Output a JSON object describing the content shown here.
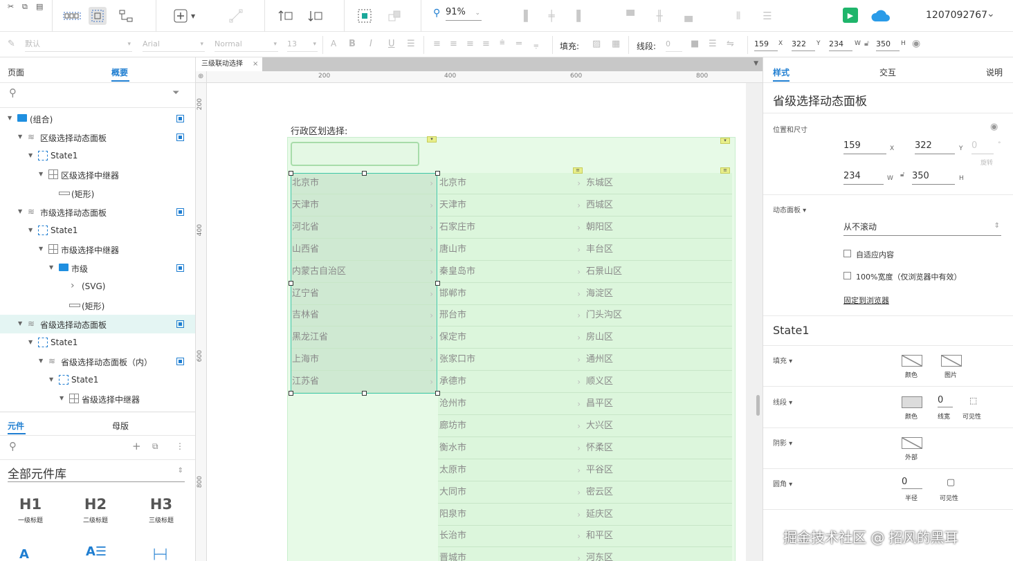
{
  "toolbar": {
    "zoom": "91%",
    "user_id": "1207092767"
  },
  "format_bar": {
    "style_select": "默认",
    "font_select": "Arial",
    "weight_select": "Normal",
    "size_select": "13",
    "fill_label": "填充:",
    "stroke_label": "线段:",
    "stroke_value": "0",
    "x_value": "159",
    "x_label": "X",
    "y_value": "322",
    "y_label": "Y",
    "w_value": "234",
    "w_label": "W",
    "h_value": "350",
    "h_label": "H"
  },
  "left_panel": {
    "tab_pages": "页面",
    "tab_outline": "概要",
    "tree": [
      {
        "label": "(组合)"
      },
      {
        "label": "区级选择动态面板"
      },
      {
        "label": "State1"
      },
      {
        "label": "区级选择中继器"
      },
      {
        "label": "(矩形)"
      },
      {
        "label": "市级选择动态面板"
      },
      {
        "label": "State1"
      },
      {
        "label": "市级选择中继器"
      },
      {
        "label": "市级"
      },
      {
        "label": "(SVG)"
      },
      {
        "label": "(矩形)"
      },
      {
        "label": "省级选择动态面板"
      },
      {
        "label": "State1"
      },
      {
        "label": "省级选择动态面板（内）"
      },
      {
        "label": "State1"
      },
      {
        "label": "省级选择中继器"
      }
    ],
    "tab_widgets": "元件",
    "tab_masters": "母版",
    "library_select": "全部元件库",
    "widgets": [
      {
        "glyph": "H1",
        "label": "一级标题"
      },
      {
        "glyph": "H2",
        "label": "二级标题"
      },
      {
        "glyph": "H3",
        "label": "三级标题"
      }
    ]
  },
  "canvas": {
    "doc_tab": "三级联动选择",
    "ruler_h": [
      "200",
      "400",
      "600",
      "800"
    ],
    "ruler_v": [
      "200",
      "400",
      "600",
      "800"
    ],
    "prompt_label": "行政区划选择:",
    "provinces": [
      "北京市",
      "天津市",
      "河北省",
      "山西省",
      "内蒙古自治区",
      "辽宁省",
      "吉林省",
      "黑龙江省",
      "上海市",
      "江苏省"
    ],
    "cities": [
      "北京市",
      "天津市",
      "石家庄市",
      "唐山市",
      "秦皇岛市",
      "邯郸市",
      "邢台市",
      "保定市",
      "张家口市",
      "承德市",
      "沧州市",
      "廊坊市",
      "衡水市",
      "太原市",
      "大同市",
      "阳泉市",
      "长治市",
      "晋城市"
    ],
    "districts": [
      "东城区",
      "西城区",
      "朝阳区",
      "丰台区",
      "石景山区",
      "海淀区",
      "门头沟区",
      "房山区",
      "通州区",
      "顺义区",
      "昌平区",
      "大兴区",
      "怀柔区",
      "平谷区",
      "密云区",
      "延庆区",
      "和平区",
      "河东区"
    ]
  },
  "right_panel": {
    "tab_style": "样式",
    "tab_interact": "交互",
    "tab_notes": "说明",
    "title": "省级选择动态面板",
    "pos_size_label": "位置和尺寸",
    "x": "159",
    "x_unit": "X",
    "y": "322",
    "y_unit": "Y",
    "rot": "0",
    "rot_unit": "°",
    "rot_label": "旋转",
    "w": "234",
    "w_unit": "W",
    "h": "350",
    "h_unit": "H",
    "dynamic_panel_label": "动态面板",
    "scroll_value": "从不滚动",
    "fit_content": "自适应内容",
    "full_width": "100%宽度（仅浏览器中有效）",
    "pin_browser": "固定到浏览器",
    "state_title": "State1",
    "fill_label": "填充",
    "fill_color": "颜色",
    "fill_image": "图片",
    "stroke_label": "线段",
    "stroke_color": "颜色",
    "stroke_width_value": "0",
    "stroke_width": "线宽",
    "stroke_visible": "可见性",
    "shadow_label": "阴影",
    "shadow_outer": "外部",
    "radius_label": "圆角",
    "radius_value": "0",
    "radius_text": "半径",
    "radius_visible": "可见性"
  },
  "watermark": "掘金技术社区 @ 招风的黑耳",
  "colors": {
    "accent": "#1f7ed1",
    "panel_green": "#dcf6dc",
    "selected_green": "#c9e9cb"
  }
}
